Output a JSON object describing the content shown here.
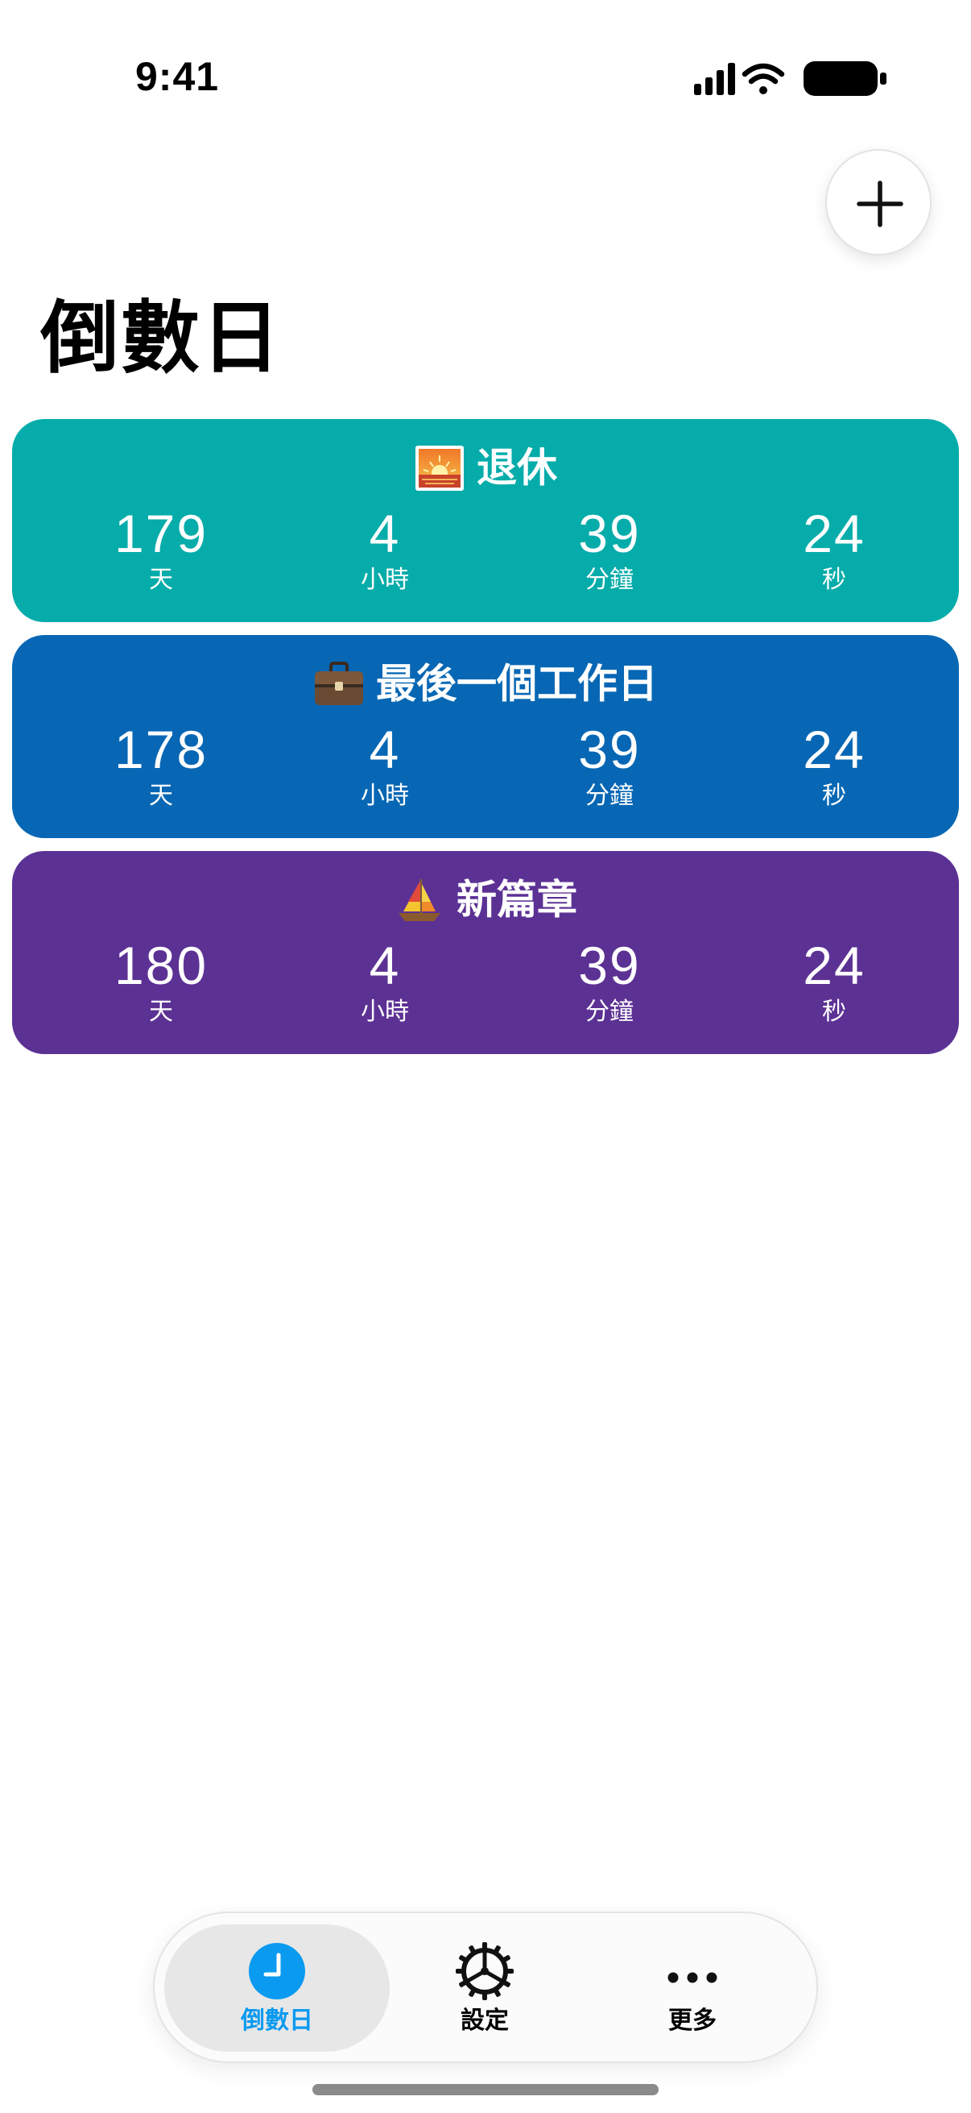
{
  "status_bar": {
    "time": "9:41"
  },
  "header": {
    "title": "倒數日"
  },
  "add_button": {
    "icon": "plus-icon"
  },
  "events": [
    {
      "emoji": "sunrise-emoji",
      "name": "退休",
      "color": "#06ACAA",
      "days": "179",
      "days_label": "天",
      "hours": "4",
      "hours_label": "小時",
      "minutes": "39",
      "minutes_label": "分鐘",
      "seconds": "24",
      "seconds_label": "秒"
    },
    {
      "emoji": "briefcase-emoji",
      "name": "最後一個工作日",
      "color": "#0767B4",
      "days": "178",
      "days_label": "天",
      "hours": "4",
      "hours_label": "小時",
      "minutes": "39",
      "minutes_label": "分鐘",
      "seconds": "24",
      "seconds_label": "秒"
    },
    {
      "emoji": "sailboat-emoji",
      "name": "新篇章",
      "color": "#5C3194",
      "days": "180",
      "days_label": "天",
      "hours": "4",
      "hours_label": "小時",
      "minutes": "39",
      "minutes_label": "分鐘",
      "seconds": "24",
      "seconds_label": "秒"
    }
  ],
  "tab_bar": {
    "selected_color": "#0A9AF0",
    "tabs": [
      {
        "label": "倒數日",
        "icon": "clock-icon",
        "selected": true
      },
      {
        "label": "設定",
        "icon": "gear-icon",
        "selected": false
      },
      {
        "label": "更多",
        "icon": "more-icon",
        "selected": false
      }
    ]
  }
}
